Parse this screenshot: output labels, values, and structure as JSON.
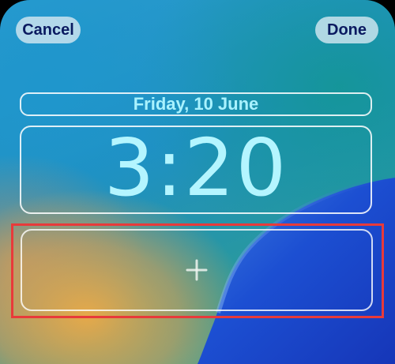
{
  "header": {
    "cancel_label": "Cancel",
    "done_label": "Done"
  },
  "lock_screen": {
    "date": "Friday, 10 June",
    "time": "3:20",
    "widget_icon": "plus-icon"
  },
  "colors": {
    "button_bg": "#d2e6f0",
    "button_text": "#0a1a60",
    "clock_text": "#b4f5ff",
    "date_text": "#a9f2ff",
    "highlight": "#e83a3a",
    "wave_blue": "#1f4fd0"
  }
}
